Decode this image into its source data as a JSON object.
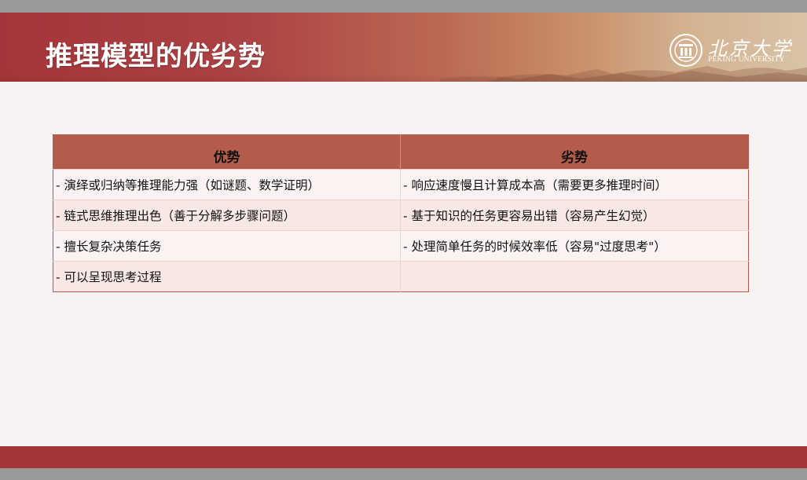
{
  "slide": {
    "title": "推理模型的优劣势",
    "logo": {
      "name_cn": "北京大学",
      "name_en": "PEKING UNIVERSITY"
    }
  },
  "table": {
    "headers": [
      "优势",
      "劣势"
    ],
    "rows": [
      [
        "- 演绎或归纳等推理能力强（如谜题、数学证明）",
        "- 响应速度慢且计算成本高（需要更多推理时间）"
      ],
      [
        "- 链式思维推理出色（善于分解多步骤问题）",
        "- 基于知识的任务更容易出错（容易产生幻觉）"
      ],
      [
        "- 擅长复杂决策任务",
        "- 处理简单任务的时候效率低（容易\"过度思考\"）"
      ],
      [
        "- 可以呈现思考过程",
        ""
      ]
    ]
  },
  "colors": {
    "brand_red": "#a5353a",
    "table_header": "#b35c4c",
    "slide_background": "#f9f2f2"
  }
}
